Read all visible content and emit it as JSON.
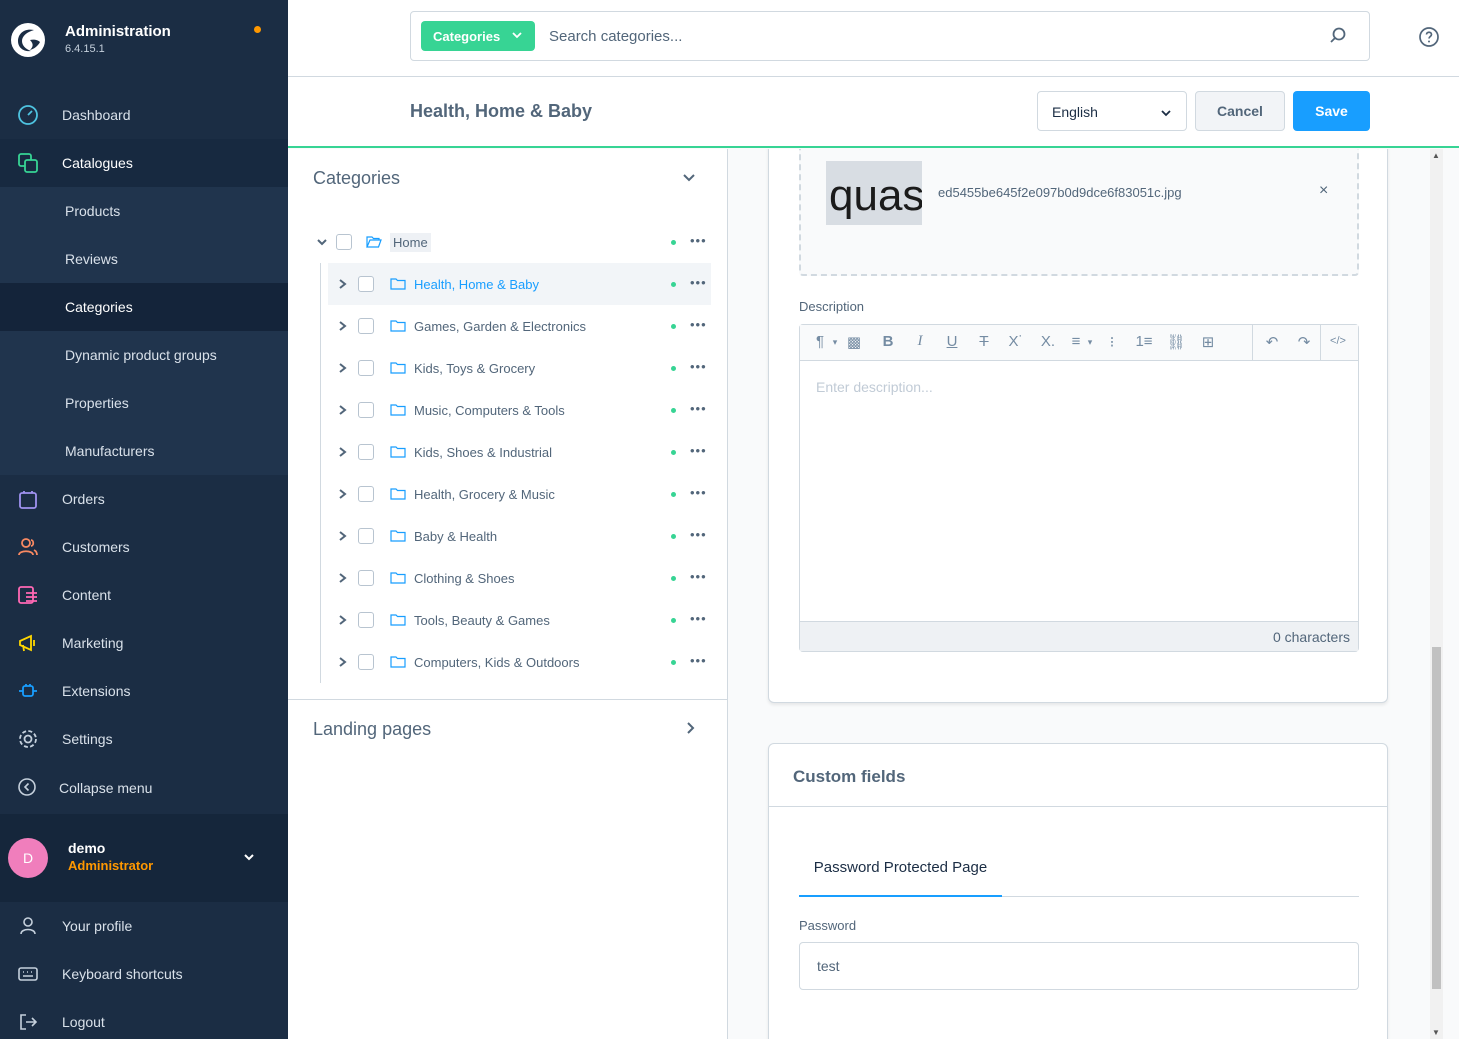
{
  "app": {
    "title": "Administration",
    "version": "6.4.15.1"
  },
  "sidebar": {
    "items": [
      {
        "label": "Dashboard",
        "icon": "dashboard-icon"
      },
      {
        "label": "Catalogues",
        "icon": "catalogue-icon"
      },
      {
        "label": "Orders",
        "icon": "orders-icon"
      },
      {
        "label": "Customers",
        "icon": "customers-icon"
      },
      {
        "label": "Content",
        "icon": "content-icon"
      },
      {
        "label": "Marketing",
        "icon": "marketing-icon"
      },
      {
        "label": "Extensions",
        "icon": "extensions-icon"
      },
      {
        "label": "Settings",
        "icon": "settings-icon"
      }
    ],
    "catalogue_sub": [
      "Products",
      "Reviews",
      "Categories",
      "Dynamic product groups",
      "Properties",
      "Manufacturers"
    ],
    "collapse": "Collapse menu",
    "user": {
      "initial": "D",
      "name": "demo",
      "role": "Administrator"
    },
    "bottom": [
      {
        "label": "Your profile",
        "icon": "user-icon"
      },
      {
        "label": "Keyboard shortcuts",
        "icon": "keyboard-icon"
      },
      {
        "label": "Logout",
        "icon": "logout-icon"
      }
    ]
  },
  "search": {
    "type_label": "Categories",
    "placeholder": "Search categories..."
  },
  "smartbar": {
    "title": "Health, Home & Baby",
    "language": "English",
    "cancel": "Cancel",
    "save": "Save"
  },
  "tree": {
    "heading": "Categories",
    "root": "Home",
    "children": [
      "Health, Home & Baby",
      "Games, Garden & Electronics",
      "Kids, Toys & Grocery",
      "Music, Computers & Tools",
      "Kids, Shoes & Industrial",
      "Health, Grocery & Music",
      "Baby & Health",
      "Clothing & Shoes",
      "Tools, Beauty & Games",
      "Computers, Kids & Outdoors"
    ],
    "landing_heading": "Landing pages"
  },
  "media": {
    "thumb_text": "quasi",
    "filename": "ed5455be645f2e097b0d9dce6f83051c.jpg",
    "remove": "×"
  },
  "description": {
    "label": "Description",
    "placeholder": "Enter description...",
    "count": "0 characters"
  },
  "custom_fields": {
    "title": "Custom fields",
    "tab": "Password Protected Page",
    "password_label": "Password",
    "password_value": "test"
  },
  "colors": {
    "sidebar_bg": "#1b2d44",
    "accent_green": "#37d494",
    "accent_blue": "#189eff",
    "notice_orange": "#ff9800"
  }
}
